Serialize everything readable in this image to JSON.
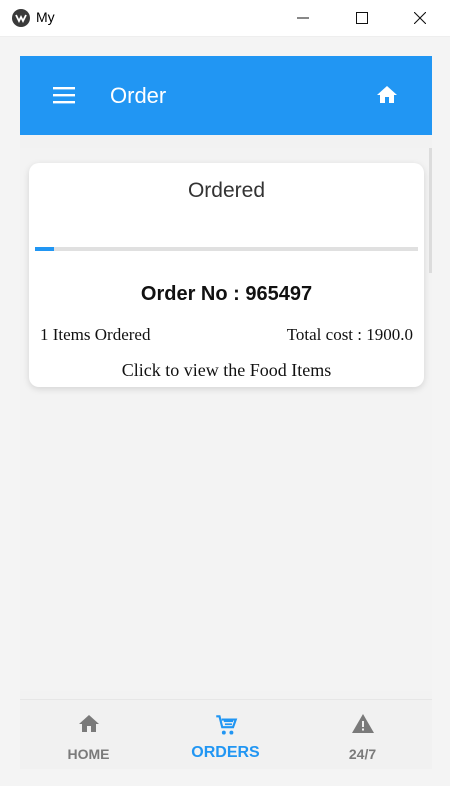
{
  "window": {
    "title": "My"
  },
  "toolbar": {
    "title": "Order"
  },
  "order": {
    "status": "Ordered",
    "progress_fraction": 0.05,
    "order_no_label": "Order No : 965497",
    "items_ordered": "1 Items Ordered",
    "total_cost": "Total cost : 1900.0",
    "view_items": "Click to view the Food Items"
  },
  "bottom_nav": {
    "items": [
      {
        "label": "HOME",
        "icon": "home-icon",
        "active": false
      },
      {
        "label": "ORDERS",
        "icon": "cart-icon",
        "active": true
      },
      {
        "label": "24/7",
        "icon": "warning-icon",
        "active": false
      }
    ]
  },
  "colors": {
    "primary": "#2196f3",
    "inactive": "#7a7a7a",
    "background": "#f3f3f3"
  }
}
